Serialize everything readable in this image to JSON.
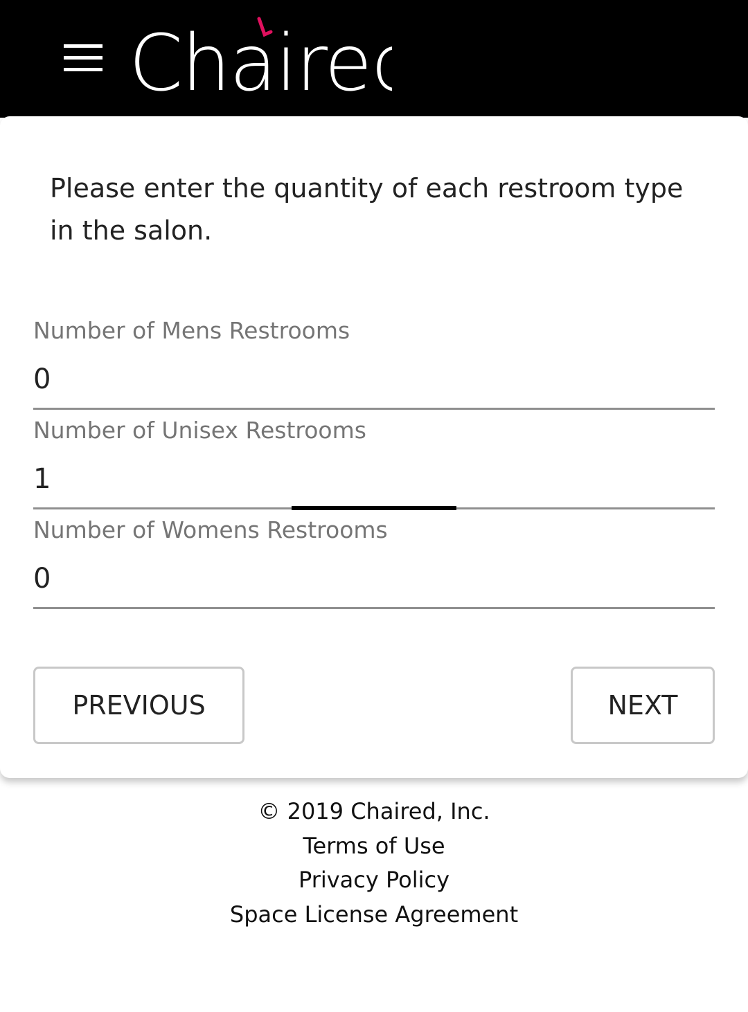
{
  "header": {
    "logo_text": "Chaired",
    "logo_accent_color": "#e0105e",
    "menu_icon": "hamburger-menu-icon"
  },
  "form": {
    "instructions": "Please enter the quantity of each restroom type in the salon.",
    "fields": [
      {
        "label": "Number of Mens Restrooms",
        "value": "0"
      },
      {
        "label": "Number of Unisex Restrooms",
        "value": "1"
      },
      {
        "label": "Number of Womens Restrooms",
        "value": "0"
      }
    ],
    "previous_label": "PREVIOUS",
    "next_label": "NEXT"
  },
  "footer": {
    "copyright": "© 2019 Chaired, Inc.",
    "terms": "Terms of Use",
    "privacy": "Privacy Policy",
    "space_license": "Space License Agreement"
  }
}
